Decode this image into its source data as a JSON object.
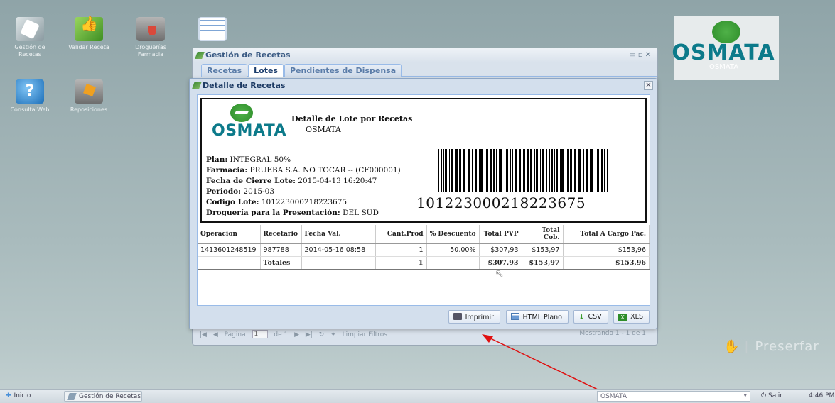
{
  "desktop": {
    "icons": [
      {
        "label": "Gestión de Recetas",
        "icon": "prescription-icon"
      },
      {
        "label": "Validar Receta",
        "icon": "thumbs-up-icon"
      },
      {
        "label": "Droguerías Farmacia",
        "icon": "pharmacy-folder-icon"
      },
      {
        "label": "Consulta Web",
        "icon": "help-icon"
      },
      {
        "label": "Reposiciones",
        "icon": "box-folder-icon"
      }
    ],
    "logo": {
      "word": "OSMATA",
      "sub": "OSMATA"
    },
    "watermark": "Preserfar"
  },
  "main_window": {
    "title": "Gestión de Recetas",
    "tabs": [
      "Recetas",
      "Lotes",
      "Pendientes de Dispensa"
    ],
    "active_tab": "Lotes",
    "pagebar": {
      "page_label": "Página",
      "page_value": "1",
      "of_label": "de 1",
      "clear_filters": "Limpiar Filtros",
      "showing": "Mostrando 1 - 1 de 1"
    }
  },
  "dialog": {
    "title": "Detalle de Recetas",
    "report": {
      "logo_word": "OSMATA",
      "heading": "Detalle de Lote por Recetas",
      "heading_sub": "OSMATA",
      "plan_label": "Plan:",
      "plan_value": "INTEGRAL 50%",
      "farmacia_label": "Farmacia:",
      "farmacia_value": "PRUEBA S.A. NO TOCAR -- (CF000001)",
      "cierre_label": "Fecha de Cierre Lote:",
      "cierre_value": "2015-04-13 16:20:47",
      "periodo_label": "Periodo:",
      "periodo_value": "2015-03",
      "codigo_label": "Codigo Lote:",
      "codigo_value": "101223000218223675",
      "drogueria_label": "Droguería para la Presentación:",
      "drogueria_value": "DEL SUD",
      "barcode_number": "101223000218223675"
    },
    "table": {
      "headers": [
        "Operacion",
        "Recetario",
        "Fecha Val.",
        "Cant.Prod",
        "% Descuento",
        "Total PVP",
        "Total Cob.",
        "Total A Cargo Pac."
      ],
      "rows": [
        [
          "1413601248519",
          "987788",
          "2014-05-16 08:58",
          "1",
          "50.00%",
          "$307,93",
          "$153,97",
          "$153,96"
        ]
      ],
      "totals": [
        "",
        "Totales",
        "",
        "1",
        "",
        "$307,93",
        "$153,97",
        "$153,96"
      ]
    },
    "buttons": {
      "print": "Imprimir",
      "html": "HTML Plano",
      "csv": "CSV",
      "xls": "XLS"
    }
  },
  "taskbar": {
    "start": "Inicio",
    "task": "Gestión de Recetas",
    "user": "OSMATA",
    "logout": "Salir",
    "time": "4:46 PM"
  },
  "colors": {
    "annotation_arrow": "#e01010",
    "brand_teal": "#0c7a8a",
    "brand_green": "#2e8d2a"
  }
}
